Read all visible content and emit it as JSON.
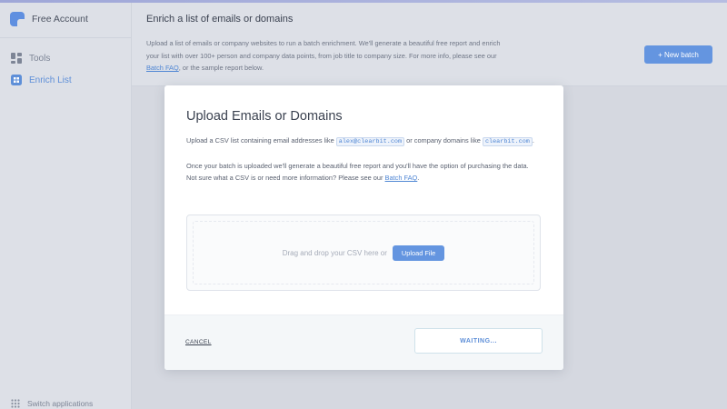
{
  "app": {
    "account_name": "Free Account"
  },
  "sidebar": {
    "items": [
      {
        "label": "Tools",
        "icon": "tools-icon",
        "active": false
      },
      {
        "label": "Enrich List",
        "icon": "enrich-list-icon",
        "active": true
      }
    ],
    "switch_label": "Switch applications"
  },
  "header": {
    "title": "Enrich a list of emails or domains",
    "desc_1": "Upload a list of emails or company websites to run a batch enrichment. We'll generate a beautiful free report and enrich your list with over 100+ person and company data points, from job title to company size. For more info, please see our ",
    "desc_link_1": "Batch FAQ",
    "desc_2": ", or the sample report below.",
    "new_batch_label": "+ New batch"
  },
  "modal": {
    "title": "Upload Emails or Domains",
    "line1_a": "Upload a CSV list containing email addresses like ",
    "email_example": "alex@clearbit.com",
    "line1_b": " or company domains like ",
    "domain_example": "clearbit.com",
    "line1_c": ".",
    "line2": "Once your batch is uploaded we'll generate a beautiful free report and you'll have the option of purchasing the data.",
    "line3_a": "Not sure what a CSV is or need more information? Please see our ",
    "line3_link": "Batch FAQ",
    "line3_b": ".",
    "drop_text": "Drag and drop your CSV here or",
    "upload_label": "Upload File",
    "cancel_label": "CANCEL",
    "waiting_label": "WAITING..."
  },
  "colors": {
    "accent": "#6495e0",
    "link": "#4f86d4",
    "sidebar_bg": "#dde0e7",
    "overlay_bg": "#d5d8e0"
  }
}
